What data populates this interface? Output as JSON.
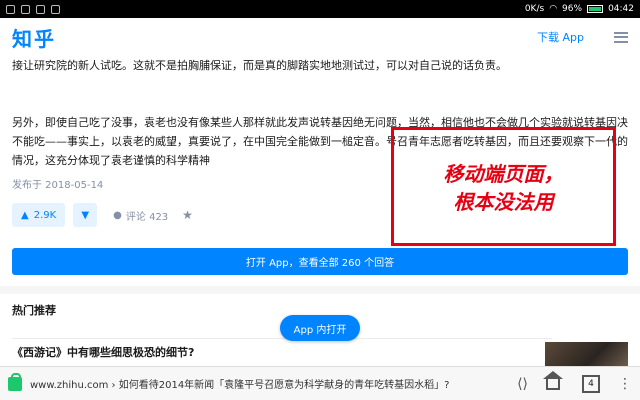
{
  "statusbar": {
    "network": "0K/s",
    "battery": "96%",
    "time": "04:42"
  },
  "header": {
    "logo": "知乎",
    "download_label": "下载 App"
  },
  "article": {
    "p1": "接让研究院的新人试吃。这就不是拍胸脯保证，而是真的脚踏实地地测试过，可以对自己说的话负责。",
    "p2": "另外，即使自己吃了没事，袁老也没有像某些人那样就此发声说转基因绝无问题，当然，相信他也不会做几个实验就说转基因决不能吃——事实上，以袁老的威望，真要说了，在中国完全能做到一槌定音。号召青年志愿者吃转基因，而且还要观察下一代的情况，这充分体现了袁老谨慎的科学精神",
    "pubdate": "发布于 2018-05-14"
  },
  "actions": {
    "upvote_count": "2.9K",
    "comment_label": "评论 423"
  },
  "open_app_bar": "打开 App，查看全部 260 个回答",
  "hot": {
    "title": "热门推荐",
    "first_item": "《西游记》中有哪些细思极恐的细节?"
  },
  "app_open_pill": "App 内打开",
  "overlay": {
    "line1": "移动端页面，",
    "line2": "根本没法用",
    "color": "#e60012"
  },
  "browser": {
    "url": "www.zhihu.com › 如何看待2014年新闻「袁隆平号召愿意为科学献身的青年吃转基因水稻」?",
    "tab_count": "4"
  },
  "colors": {
    "brand": "#0084ff"
  }
}
